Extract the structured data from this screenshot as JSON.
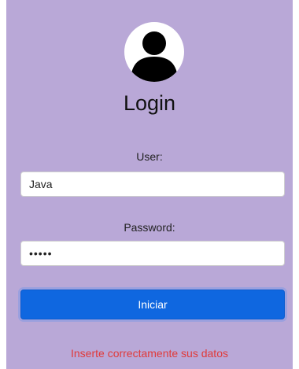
{
  "colors": {
    "panel_background": "#b9a8d7",
    "button_background": "#0f67e0",
    "error_text": "#e03a3a"
  },
  "icons": {
    "avatar": "user-silhouette-icon"
  },
  "login": {
    "title": "Login",
    "user_label": "User:",
    "user_value": "Java",
    "password_label": "Password:",
    "password_value": "•••••",
    "submit_label": "Iniciar",
    "error_message": "Inserte correctamente sus datos"
  }
}
